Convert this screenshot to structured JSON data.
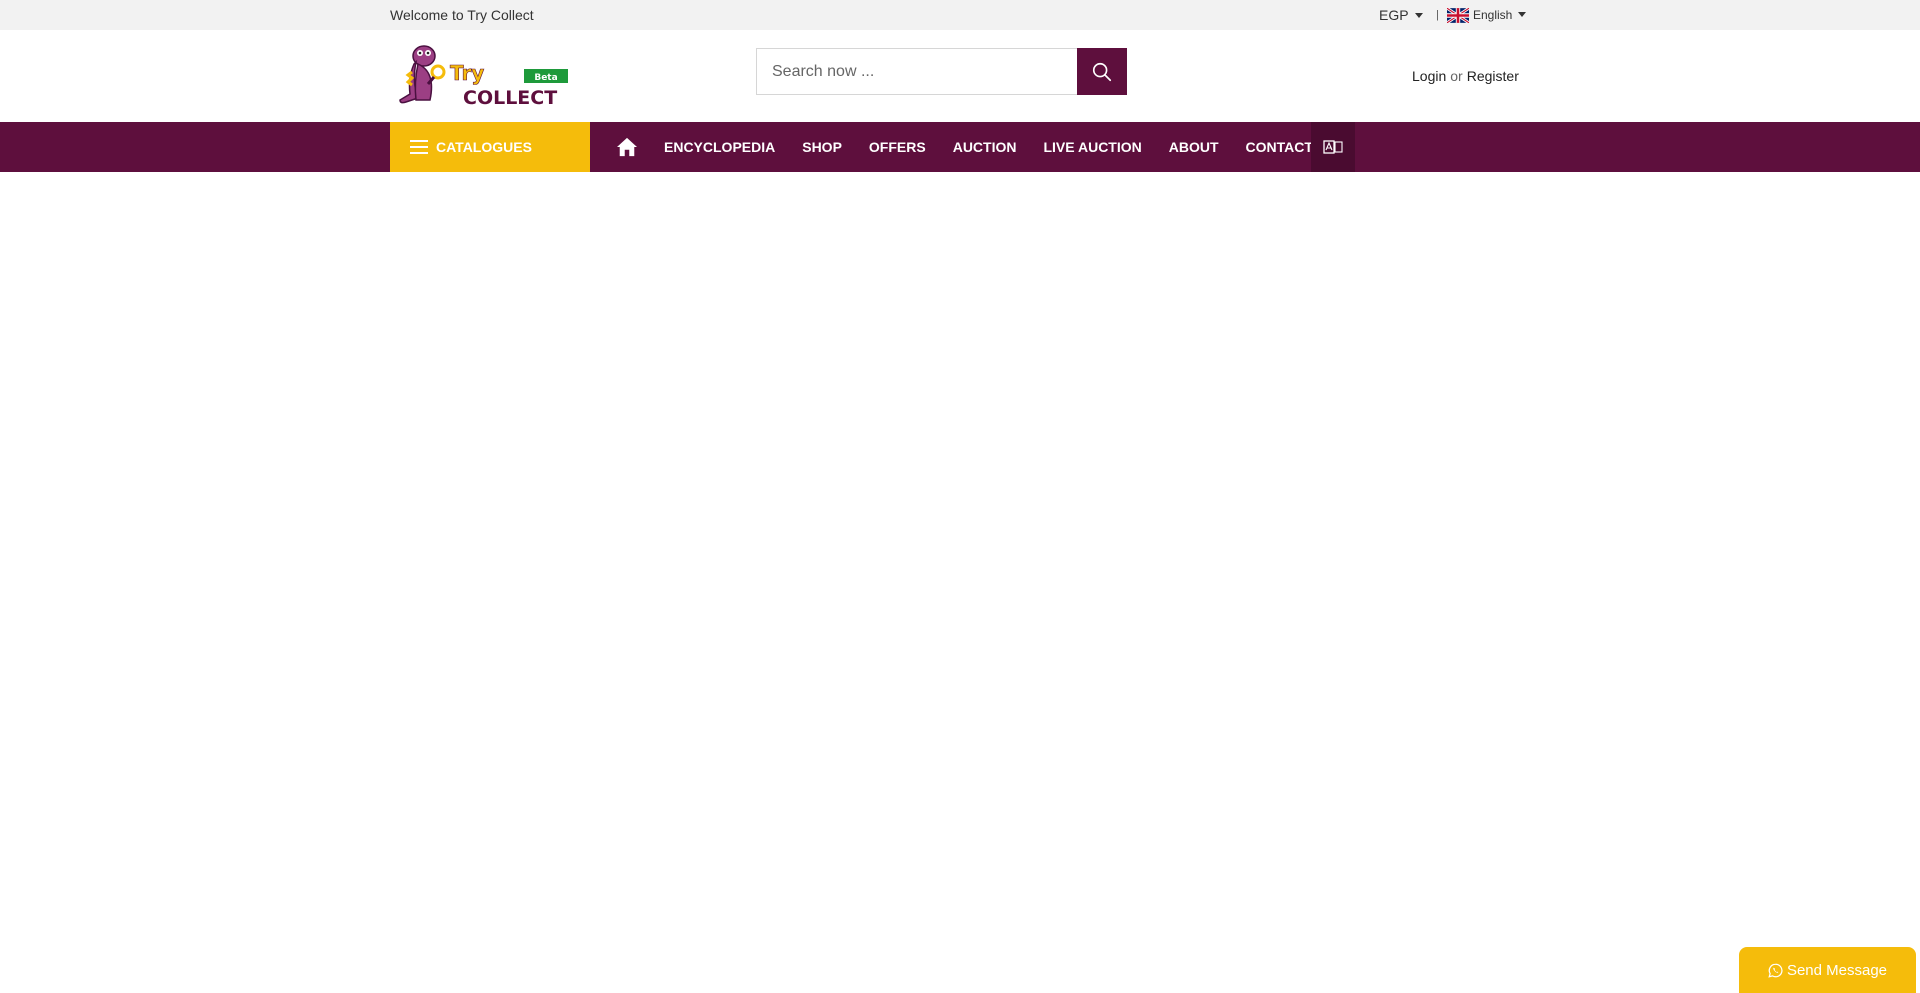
{
  "topbar": {
    "welcome": "Welcome to Try Collect",
    "currency": "EGP",
    "separator": "|",
    "language": "English"
  },
  "header": {
    "logo": {
      "word_try": "Try",
      "word_collect": "COLLECT",
      "badge": "Beta"
    },
    "search": {
      "placeholder": "Search now ..."
    },
    "auth": {
      "login": "Login",
      "or": "or",
      "register": "Register"
    }
  },
  "nav": {
    "catalogues": "CATALOGUES",
    "items": [
      "ENCYCLOPEDIA",
      "SHOP",
      "OFFERS",
      "AUCTION",
      "LIVE AUCTION",
      "ABOUT",
      "CONTACT"
    ]
  },
  "floating": {
    "send_message": "Send Message"
  },
  "colors": {
    "brand_purple": "#5e0f3d",
    "brand_yellow": "#f5bc0b",
    "topbar_bg": "#f2f2f2"
  },
  "icons": {
    "search": "search-icon",
    "home": "home-icon",
    "menu": "hamburger-icon",
    "translate": "translate-icon",
    "whatsapp": "whatsapp-icon",
    "flag": "uk-flag-icon"
  }
}
